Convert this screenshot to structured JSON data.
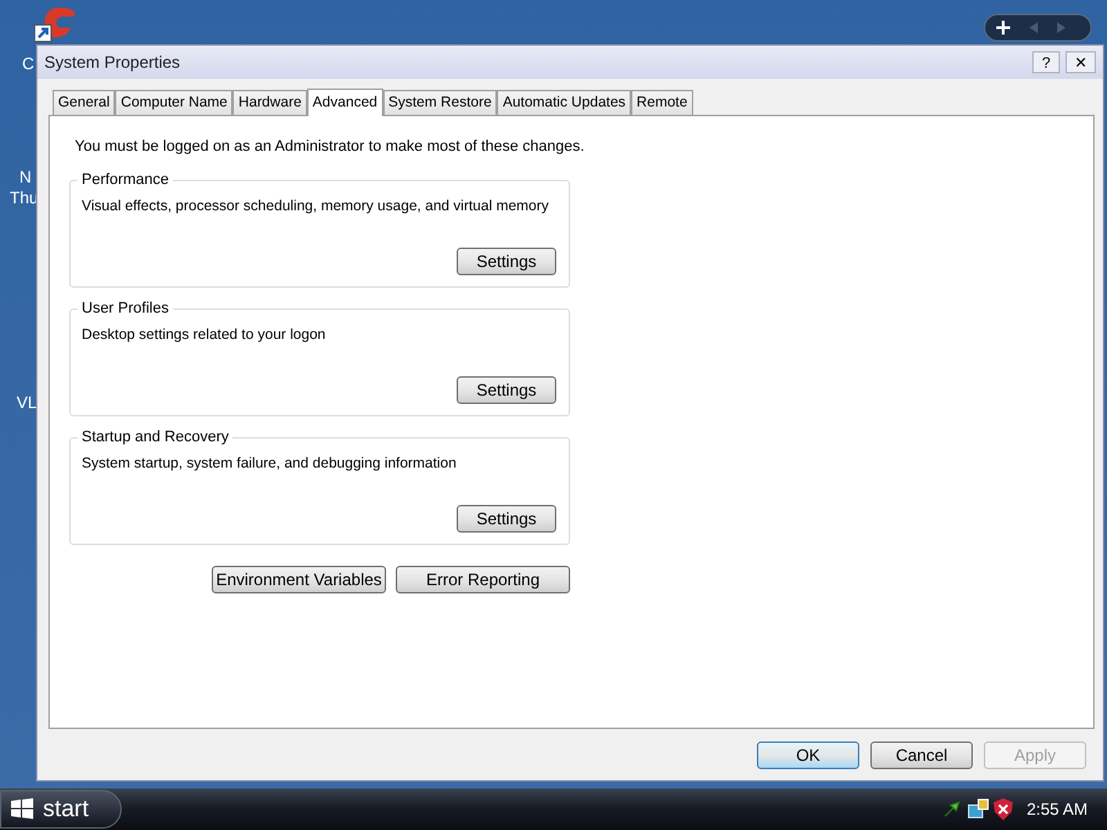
{
  "desktop": {
    "icon_labels": [
      "C",
      "N",
      "Thu",
      "VL"
    ]
  },
  "window": {
    "title": "System Properties",
    "help_button": "?",
    "close_button": "✕"
  },
  "tabs": [
    {
      "label": "General",
      "selected": false
    },
    {
      "label": "Computer Name",
      "selected": false
    },
    {
      "label": "Hardware",
      "selected": false
    },
    {
      "label": "Advanced",
      "selected": true
    },
    {
      "label": "System Restore",
      "selected": false
    },
    {
      "label": "Automatic Updates",
      "selected": false
    },
    {
      "label": "Remote",
      "selected": false
    }
  ],
  "notice": "You must be logged on as an Administrator to make most of these changes.",
  "groups": [
    {
      "title": "Performance",
      "description": "Visual effects, processor scheduling, memory usage, and virtual memory",
      "button": "Settings"
    },
    {
      "title": "User Profiles",
      "description": "Desktop settings related to your logon",
      "button": "Settings"
    },
    {
      "title": "Startup and Recovery",
      "description": "System startup, system failure, and debugging information",
      "button": "Settings"
    }
  ],
  "extra_buttons": [
    "Environment Variables",
    "Error Reporting"
  ],
  "dialog_buttons": [
    {
      "label": "OK",
      "disabled": false
    },
    {
      "label": "Cancel",
      "disabled": false
    },
    {
      "label": "Apply",
      "disabled": true
    }
  ],
  "taskbar": {
    "start": "start",
    "clock": "2:55 AM"
  }
}
